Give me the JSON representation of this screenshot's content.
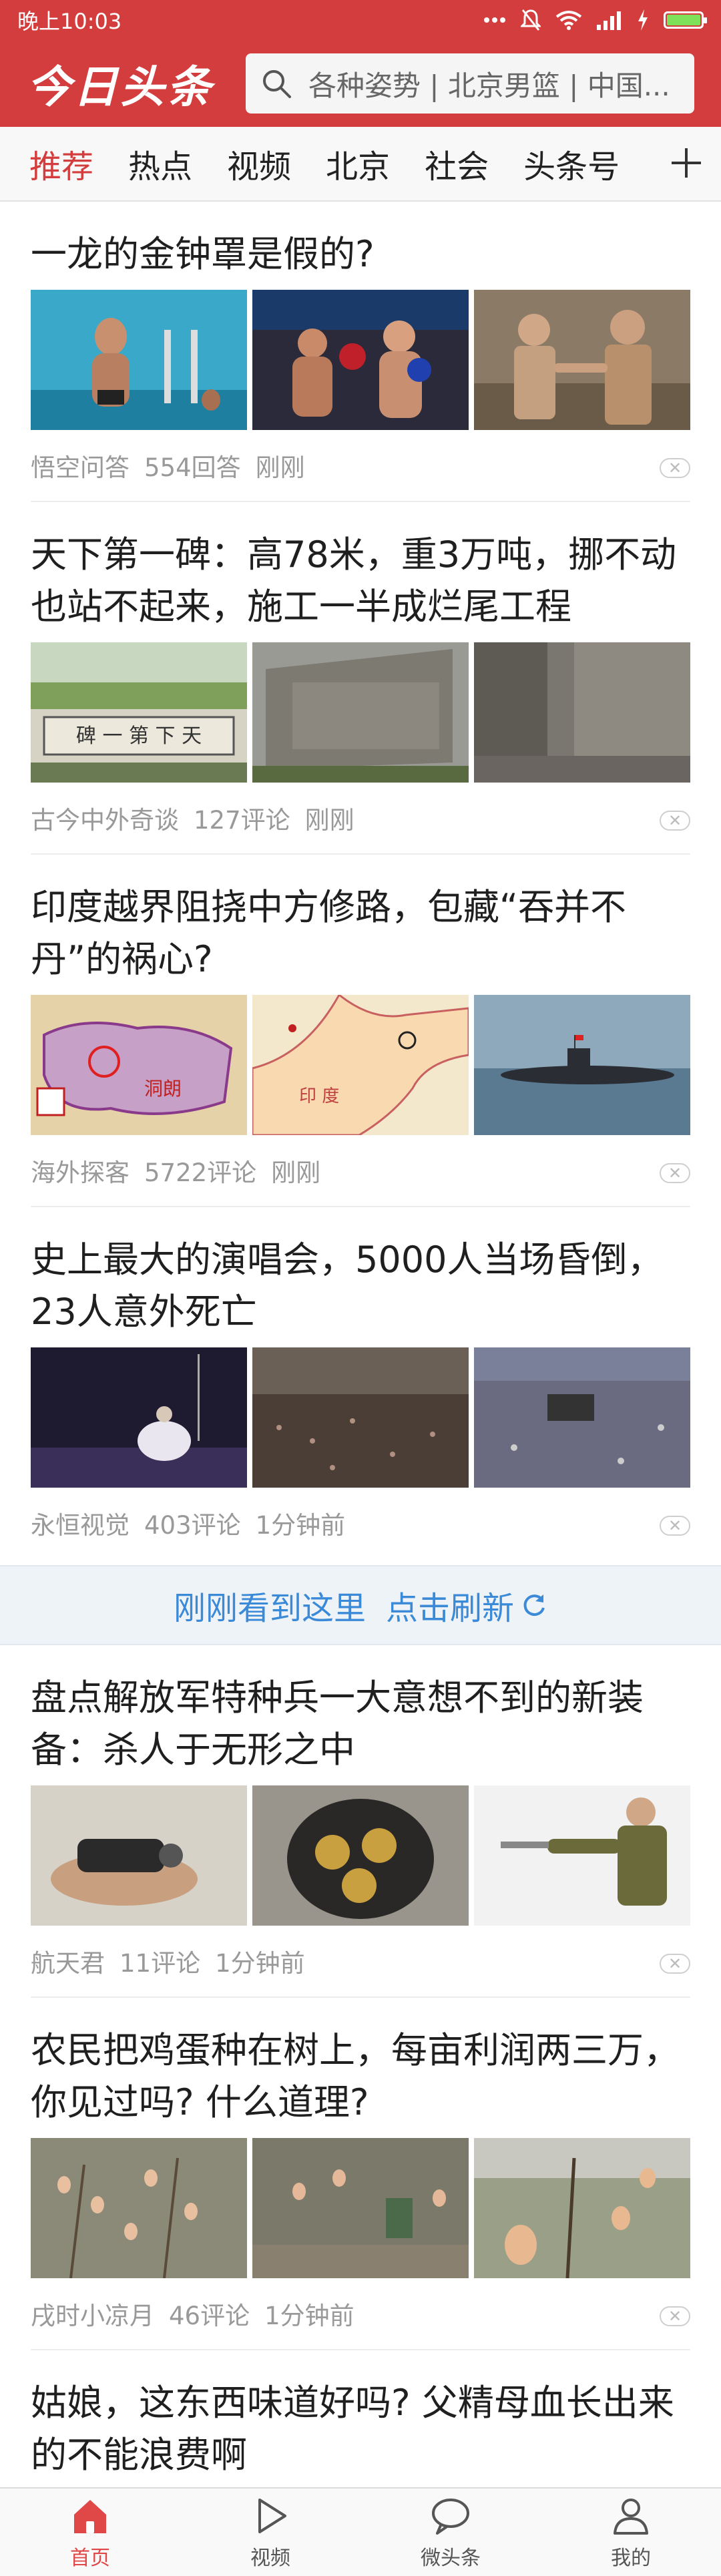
{
  "status_bar": {
    "time": "晚上10:03",
    "icons": [
      "dots-icon",
      "mute-icon",
      "wifi-icon",
      "signal-icon",
      "charging-icon",
      "battery-icon"
    ],
    "battery_level": 1.0
  },
  "header": {
    "logo": "今日头条",
    "search_placeholder": "各种姿势 | 北京男篮 | 中国...",
    "brand_color": "#d43d3d"
  },
  "tabs": [
    {
      "label": "推荐",
      "active": true
    },
    {
      "label": "热点"
    },
    {
      "label": "视频"
    },
    {
      "label": "北京"
    },
    {
      "label": "社会"
    },
    {
      "label": "头条号"
    }
  ],
  "articles": [
    {
      "title": "一龙的金钟罩是假的?",
      "source": "悟空问答",
      "count": "554回答",
      "time": "刚刚",
      "images": [
        {
          "icon": "swimmer-photo",
          "bg": "#3aa9c9"
        },
        {
          "icon": "boxing-photo",
          "bg": "#2a2a3a"
        },
        {
          "icon": "fighters-photo",
          "bg": "#8a7a66"
        }
      ]
    },
    {
      "title": "天下第一碑：高78米，重3万吨，挪不动也站不起来，施工一半成烂尾工程",
      "source": "古今中外奇谈",
      "count": "127评论",
      "time": "刚刚",
      "images": [
        {
          "icon": "stele-photo",
          "bg": "#7fa05a"
        },
        {
          "icon": "cliff-photo",
          "bg": "#8d8d8a"
        },
        {
          "icon": "stone-photo",
          "bg": "#7a7670"
        }
      ]
    },
    {
      "title": "印度越界阻挠中方修路，包藏“吞并不丹”的祸心?",
      "source": "海外探客",
      "count": "5722评论",
      "time": "刚刚",
      "images": [
        {
          "icon": "map-photo",
          "bg": "#e6d2a8"
        },
        {
          "icon": "map2-photo",
          "bg": "#f1e4c8"
        },
        {
          "icon": "submarine-photo",
          "bg": "#6e8ea8"
        }
      ]
    },
    {
      "title": "史上最大的演唱会，5000人当场昏倒，23人意外死亡",
      "source": "永恒视觉",
      "count": "403评论",
      "time": "1分钟前",
      "images": [
        {
          "icon": "stage-photo",
          "bg": "#2b2540"
        },
        {
          "icon": "crowd-photo",
          "bg": "#3d3530"
        },
        {
          "icon": "stadium-photo",
          "bg": "#5a5f80"
        }
      ]
    },
    {
      "title": "盘点解放军特种兵一大意想不到的新装备：杀人于无形之中",
      "source": "航天君",
      "count": "11评论",
      "time": "1分钟前",
      "images": [
        {
          "icon": "device-photo",
          "bg": "#d7d2c8"
        },
        {
          "icon": "barrel-photo",
          "bg": "#9a958c"
        },
        {
          "icon": "soldier-photo",
          "bg": "#eeeeee"
        }
      ]
    },
    {
      "title": "农民把鸡蛋种在树上，每亩利润两三万，你见过吗? 什么道理?",
      "source": "戌时小凉月",
      "count": "46评论",
      "time": "1分钟前",
      "images": [
        {
          "icon": "eggtree-photo",
          "bg": "#8b8a78"
        },
        {
          "icon": "orchard-photo",
          "bg": "#7b7a6a"
        },
        {
          "icon": "egg-closeup-photo",
          "bg": "#9aa088"
        }
      ]
    },
    {
      "title": "姑娘，这东西味道好吗? 父精母血长出来的不能浪费啊",
      "source": "",
      "count": "",
      "time": "",
      "images": []
    }
  ],
  "refresh": {
    "text1": "刚刚看到这里",
    "text2": "点击刷新"
  },
  "bottom_nav": [
    {
      "label": "首页",
      "icon": "home-icon",
      "active": true
    },
    {
      "label": "视频",
      "icon": "play-icon"
    },
    {
      "label": "微头条",
      "icon": "chat-bubble-icon"
    },
    {
      "label": "我的",
      "icon": "person-icon"
    }
  ]
}
